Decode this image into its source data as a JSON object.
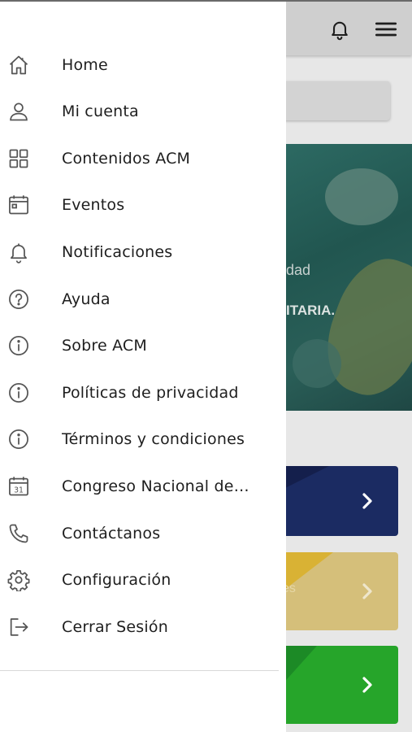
{
  "background": {
    "banner_text_1": "dad",
    "banner_text_2": "ITARIA.",
    "card2_text": "es"
  },
  "drawer": {
    "items": [
      {
        "label": "Home",
        "icon": "home-icon"
      },
      {
        "label": "Mi cuenta",
        "icon": "user-icon"
      },
      {
        "label": "Contenidos ACM",
        "icon": "grid-icon"
      },
      {
        "label": "Eventos",
        "icon": "calendar-icon"
      },
      {
        "label": "Notificaciones",
        "icon": "bell-icon"
      },
      {
        "label": "Ayuda",
        "icon": "help-icon"
      },
      {
        "label": "Sobre ACM",
        "icon": "info-icon"
      },
      {
        "label": "Políticas de privacidad",
        "icon": "info-icon"
      },
      {
        "label": "Términos y condiciones",
        "icon": "info-icon"
      },
      {
        "label": "Congreso Nacional de ...",
        "icon": "calendar-31-icon"
      },
      {
        "label": "Contáctanos",
        "icon": "phone-icon"
      },
      {
        "label": "Configuración",
        "icon": "gear-icon"
      },
      {
        "label": "Cerrar Sesión",
        "icon": "logout-icon"
      }
    ]
  },
  "colors": {
    "drawer_bg": "#ffffff",
    "icon_stroke": "#555555",
    "card_blue": "#1b2b62",
    "card_gold": "#d5bf7a",
    "card_green": "#26a52a"
  }
}
